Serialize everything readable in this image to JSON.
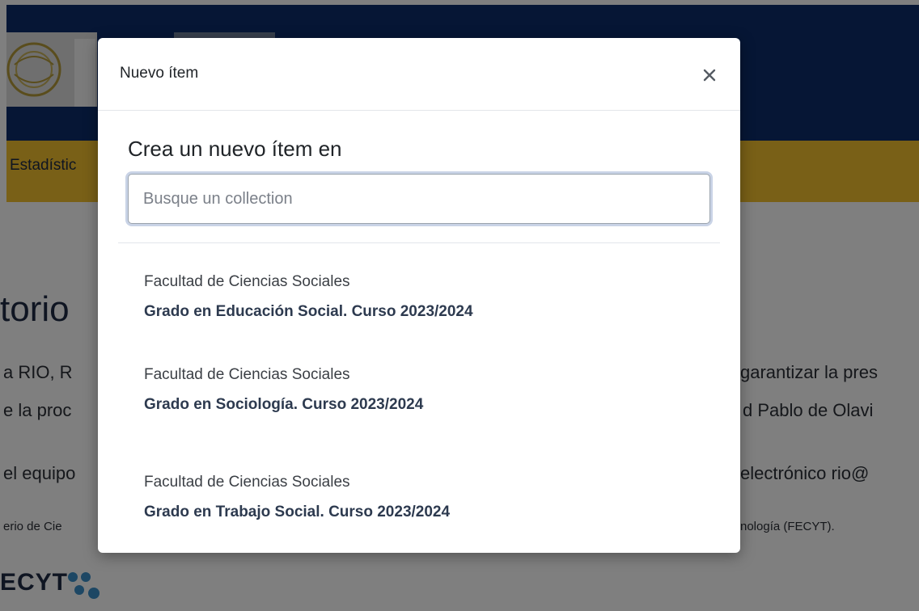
{
  "background": {
    "nav_item": "Estadístic",
    "title_fragment": "torio",
    "left_lines": [
      "a RIO, R",
      "e la proc",
      "el equipo",
      "erio de Cie"
    ],
    "right_lines": [
      "garantizar la pres",
      "d Pablo de Olavi",
      "electrónico rio@",
      "nología (FECYT)."
    ],
    "fecyt_logo": "ECYT"
  },
  "modal": {
    "title": "Nuevo ítem",
    "close_icon": "close-icon",
    "prompt": "Crea un nuevo ítem en",
    "search_placeholder": "Busque un collection",
    "collections": [
      {
        "parent": "Facultad de Ciencias Sociales",
        "name": "Grado en Educación Social. Curso 2023/2024"
      },
      {
        "parent": "Facultad de Ciencias Sociales",
        "name": "Grado en Sociología. Curso 2023/2024"
      },
      {
        "parent": "Facultad de Ciencias Sociales",
        "name": "Grado en Trabajo Social. Curso 2023/2024"
      }
    ]
  },
  "colors": {
    "header": "#0d2d6b",
    "navbar": "#f2c12e",
    "backdrop": "rgba(0,0,0,0.5)",
    "collection_name": "#2d3a4f"
  }
}
